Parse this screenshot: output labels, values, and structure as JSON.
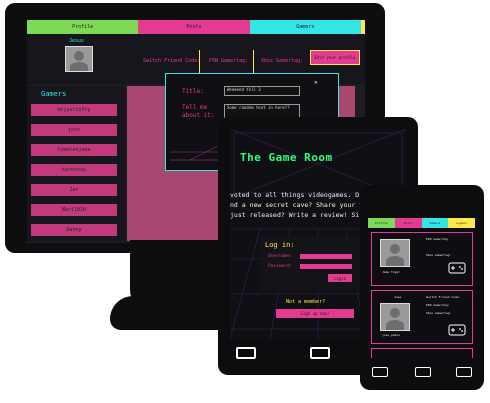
{
  "colors": {
    "tab_green": "#7ed957",
    "tab_pink": "#e23b8f",
    "tab_cyan": "#34e5e5",
    "tab_yellow": "#fbe94a",
    "accent_pink": "#e23b8f",
    "title_green": "#2cfe7e"
  },
  "desktop": {
    "tabs": [
      "Profile",
      "Posts",
      "Gamers"
    ],
    "username": "Jesus",
    "switch_label": "Switch Friend Code:",
    "psn_label": "PSN Gamertag:",
    "xbox_label": "Xbox Gamertag:",
    "edit_button": "Edit your profile",
    "gamers_title": "Gamers",
    "gamers": [
      "mrjustinfry",
      "jots",
      "timoteojake",
      "karostus",
      "Jer",
      "Mari1010",
      "Danny"
    ],
    "modal": {
      "title_label": "Title:",
      "title_value": "Weekend Yell 3",
      "tell_label": "Tell me about it:",
      "tell_value": "Some random text in here??",
      "close_icon": "close-icon"
    }
  },
  "tablet": {
    "title": "The Game Room",
    "intro_lines": [
      "voted to all things videogames. Di",
      "nd a new secret cave? Share your t",
      "just released? Write a review! Si"
    ],
    "login": {
      "title": "Log in:",
      "username_label": "Username:",
      "password_label": "Password:",
      "button": "Login"
    },
    "signup": {
      "prompt": "Not a member?",
      "button": "Sign up now!"
    }
  },
  "phone": {
    "tabs": [
      "Profile",
      "Posts",
      "Gamers",
      "Logout"
    ],
    "cards": [
      {
        "name": "Jake Tiger",
        "codes": [
          "PSN Gamertag",
          "Xbox Gamertag:"
        ],
        "icon": "gamepad-icon"
      },
      {
        "name": "jose_pablo",
        "codes": [
          "Switch Friend Code:",
          "PSN Gamertag:",
          "Xbox Gamertag:"
        ],
        "icon": "gamepad-icon"
      }
    ]
  }
}
